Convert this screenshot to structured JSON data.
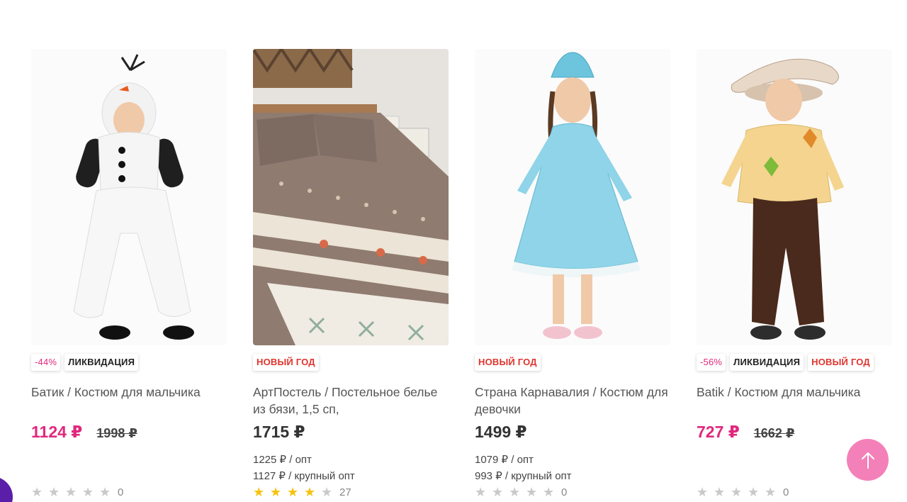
{
  "products": [
    {
      "badges": [
        {
          "type": "discount",
          "text": "-44%"
        },
        {
          "type": "liquid",
          "text": "ЛИКВИДАЦИЯ"
        }
      ],
      "title": "Батик / Костюм для мальчика",
      "price": "1124 ₽",
      "old_price": "1998 ₽",
      "wholesale": [],
      "rating": 0,
      "reviews": "0"
    },
    {
      "badges": [
        {
          "type": "newyear",
          "text": "НОВЫЙ ГОД"
        }
      ],
      "title": "АртПостель / Постельное белье из бязи, 1,5 сп,",
      "price": "1715 ₽",
      "old_price": "",
      "wholesale": [
        "1225 ₽ / опт",
        "1127 ₽ / крупный опт"
      ],
      "rating": 4,
      "reviews": "27"
    },
    {
      "badges": [
        {
          "type": "newyear",
          "text": "НОВЫЙ ГОД"
        }
      ],
      "title": "Страна Карнавалия / Костюм для девочки",
      "price": "1499 ₽",
      "old_price": "",
      "wholesale": [
        "1079 ₽ / опт",
        "993 ₽ / крупный опт"
      ],
      "rating": 0,
      "reviews": "0"
    },
    {
      "badges": [
        {
          "type": "discount",
          "text": "-56%"
        },
        {
          "type": "liquid",
          "text": "ЛИКВИДАЦИЯ"
        },
        {
          "type": "newyear",
          "text": "НОВЫЙ ГОД"
        }
      ],
      "title": "Batik / Костюм для мальчика",
      "price": "727 ₽",
      "old_price": "1662 ₽",
      "wholesale": [],
      "rating": 0,
      "reviews": "0"
    }
  ],
  "colors": {
    "sale_price": "#e0287d",
    "new_year_badge": "#e0342d",
    "star_filled": "#f7c20e",
    "star_empty": "#c9c9c9",
    "scroll_top_button": "#f480b9"
  },
  "icons": {
    "scroll_top": "arrow-up-icon",
    "star": "star-icon"
  }
}
